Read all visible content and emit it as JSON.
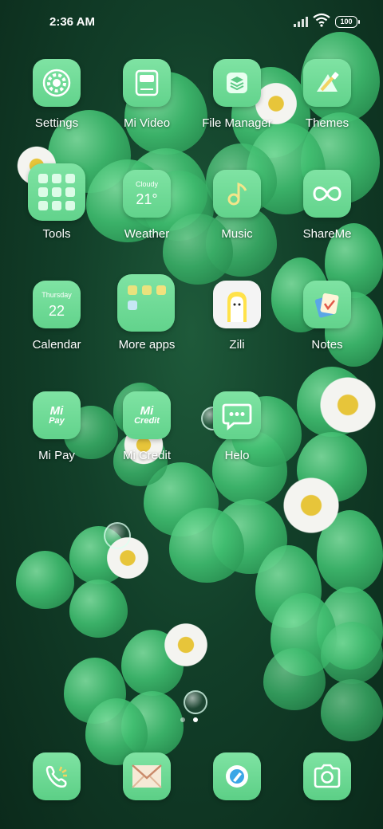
{
  "status_bar": {
    "time": "2:36 AM",
    "battery": "100"
  },
  "apps": [
    {
      "label": "Settings",
      "icon": "gear-icon"
    },
    {
      "label": "Mi Video",
      "icon": "video-icon"
    },
    {
      "label": "File Manager",
      "icon": "layers-icon"
    },
    {
      "label": "Themes",
      "icon": "brush-icon"
    },
    {
      "label": "Tools",
      "icon": "folder-icon"
    },
    {
      "label": "Weather",
      "icon": "weather-icon",
      "condition": "Cloudy",
      "temp": "21°"
    },
    {
      "label": "Music",
      "icon": "music-note-icon"
    },
    {
      "label": "ShareMe",
      "icon": "infinity-icon"
    },
    {
      "label": "Calendar",
      "icon": "calendar-icon",
      "weekday": "Thursday",
      "day": "22"
    },
    {
      "label": "More apps",
      "icon": "folder-icon"
    },
    {
      "label": "Zili",
      "icon": "zili-icon"
    },
    {
      "label": "Notes",
      "icon": "notes-icon"
    },
    {
      "label": "Mi Pay",
      "icon": "mi-pay-icon",
      "mark": "Mi",
      "sub": "Pay"
    },
    {
      "label": "Mi Credit",
      "icon": "mi-credit-icon",
      "mark": "Mi",
      "sub": "Credit"
    },
    {
      "label": "Helo",
      "icon": "chat-bubble-icon"
    }
  ],
  "dock": [
    {
      "icon": "phone-icon"
    },
    {
      "icon": "messages-icon"
    },
    {
      "icon": "browser-icon"
    },
    {
      "icon": "camera-icon"
    }
  ],
  "page_indicator": {
    "pages": 2,
    "current": 2
  },
  "colors": {
    "icon_green": "#6fd996",
    "wallpaper_dark": "#123f29"
  }
}
